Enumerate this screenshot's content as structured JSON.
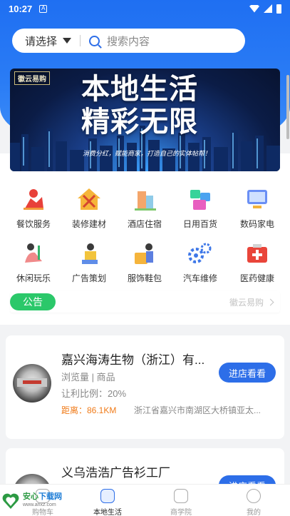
{
  "status_bar": {
    "time": "10:27",
    "notification": "A"
  },
  "search": {
    "select_label": "请选择",
    "placeholder": "搜索内容"
  },
  "banner": {
    "logo": "徽云易购",
    "title_line1": "本地生活",
    "title_line2": "精彩无限",
    "slogan": "消费分红，赋能商家，打造自己的实体帖帮！"
  },
  "categories": [
    {
      "label": "餐饮服务",
      "icon": "dining-icon"
    },
    {
      "label": "装修建材",
      "icon": "renovation-icon"
    },
    {
      "label": "酒店住宿",
      "icon": "hotel-icon"
    },
    {
      "label": "日用百货",
      "icon": "daily-goods-icon"
    },
    {
      "label": "数码家电",
      "icon": "electronics-icon"
    },
    {
      "label": "休闲玩乐",
      "icon": "leisure-icon"
    },
    {
      "label": "广告策划",
      "icon": "advertising-icon"
    },
    {
      "label": "服饰鞋包",
      "icon": "apparel-icon"
    },
    {
      "label": "汽车维修",
      "icon": "car-repair-icon"
    },
    {
      "label": "医药健康",
      "icon": "medicine-icon"
    }
  ],
  "notice": {
    "badge": "公告",
    "more": "徽云易购"
  },
  "stores": [
    {
      "name": "嘉兴海涛生物（浙江）有...",
      "meta": "浏览量 | 商品",
      "ratio": "让利比例：20%",
      "distance": "距离：86.1KM",
      "address": "浙江省嘉兴市南湖区大桥镇亚太...",
      "button": "进店看看"
    },
    {
      "name": "义乌浩浩广告衫工厂",
      "button": "进店看看"
    }
  ],
  "bottom_nav": {
    "items": [
      {
        "label": "本地生活",
        "active": true
      },
      {
        "label": "购物车"
      },
      {
        "label": "商学院"
      },
      {
        "label": "我的"
      }
    ]
  },
  "watermark": {
    "line1a": "安心",
    "line1b": "下载网",
    "line2": "www.anxz.com"
  },
  "colors": {
    "primary": "#2d6ee8",
    "notice": "#2bc86a",
    "distance": "#f07b19"
  }
}
